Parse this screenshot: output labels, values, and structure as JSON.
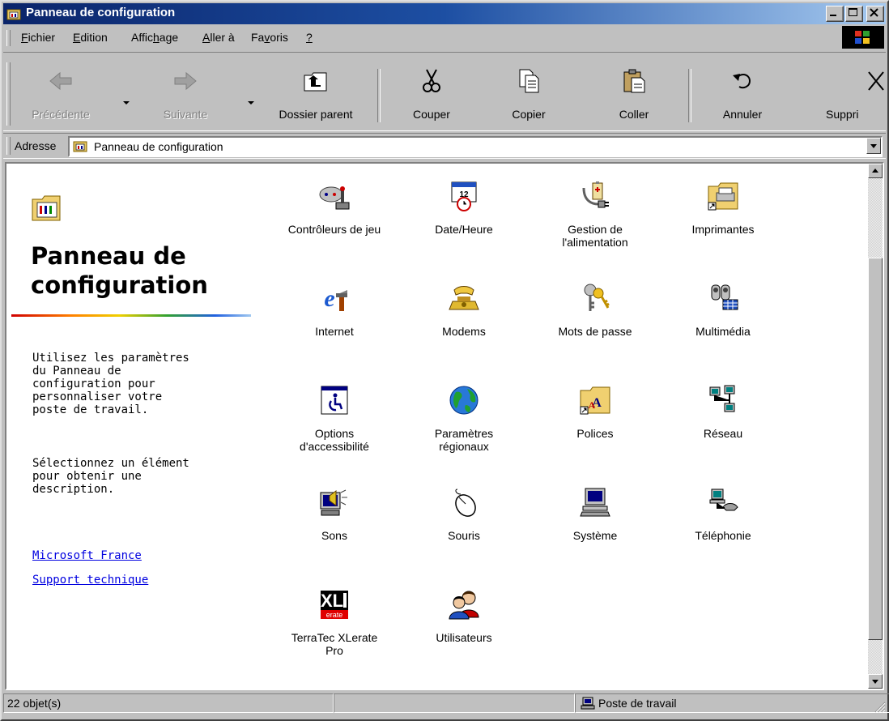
{
  "window": {
    "title": "Panneau de configuration"
  },
  "menu": [
    {
      "pre": "",
      "u": "F",
      "post": "ichier"
    },
    {
      "pre": "",
      "u": "E",
      "post": "dition"
    },
    {
      "pre": "Affic",
      "u": "h",
      "post": "age"
    },
    {
      "pre": "",
      "u": "A",
      "post": "ller à"
    },
    {
      "pre": "Fa",
      "u": "v",
      "post": "oris"
    },
    {
      "pre": "",
      "u": "?",
      "post": ""
    }
  ],
  "toolbar": {
    "back": "Précédente",
    "forward": "Suivante",
    "parent": "Dossier parent",
    "cut": "Couper",
    "copy": "Copier",
    "paste": "Coller",
    "undo": "Annuler",
    "delete": "Suppri"
  },
  "address": {
    "label": "Adresse",
    "value": "Panneau de configuration"
  },
  "left_pane": {
    "title_line1": "Panneau de",
    "title_line2": "configuration",
    "desc1_l1": "Utilisez les paramètres",
    "desc1_l2": "du Panneau de",
    "desc1_l3": "configuration pour",
    "desc1_l4": "personnaliser votre",
    "desc1_l5": "poste de travail.",
    "desc2_l1": "Sélectionnez un élément",
    "desc2_l2": "pour obtenir une",
    "desc2_l3": "description.",
    "link1": "Microsoft France",
    "link2": "Support technique"
  },
  "items": [
    {
      "l1": "Contrôleurs de jeu",
      "l2": "",
      "icon": "joystick-icon"
    },
    {
      "l1": "Date/Heure",
      "l2": "",
      "icon": "calendar-clock-icon"
    },
    {
      "l1": "Gestion de",
      "l2": "l'alimentation",
      "icon": "power-plug-icon"
    },
    {
      "l1": "Imprimantes",
      "l2": "",
      "icon": "printer-folder-icon"
    },
    {
      "l1": "Internet",
      "l2": "",
      "icon": "internet-explorer-icon"
    },
    {
      "l1": "Modems",
      "l2": "",
      "icon": "telephone-modem-icon"
    },
    {
      "l1": "Mots de passe",
      "l2": "",
      "icon": "keys-icon"
    },
    {
      "l1": "Multimédia",
      "l2": "",
      "icon": "multimedia-icon"
    },
    {
      "l1": "Options",
      "l2": "d'accessibilité",
      "icon": "accessibility-icon"
    },
    {
      "l1": "Paramètres",
      "l2": "régionaux",
      "icon": "globe-icon"
    },
    {
      "l1": "Polices",
      "l2": "",
      "icon": "fonts-folder-icon"
    },
    {
      "l1": "Réseau",
      "l2": "",
      "icon": "network-icon"
    },
    {
      "l1": "Sons",
      "l2": "",
      "icon": "speaker-icon"
    },
    {
      "l1": "Souris",
      "l2": "",
      "icon": "mouse-icon"
    },
    {
      "l1": "Système",
      "l2": "",
      "icon": "computer-icon"
    },
    {
      "l1": "Téléphonie",
      "l2": "",
      "icon": "telephony-icon"
    },
    {
      "l1": "TerraTec XLerate",
      "l2": "Pro",
      "icon": "xlerate-icon"
    },
    {
      "l1": "Utilisateurs",
      "l2": "",
      "icon": "users-icon"
    }
  ],
  "status": {
    "count": "22 objet(s)",
    "zone": "Poste de travail"
  }
}
